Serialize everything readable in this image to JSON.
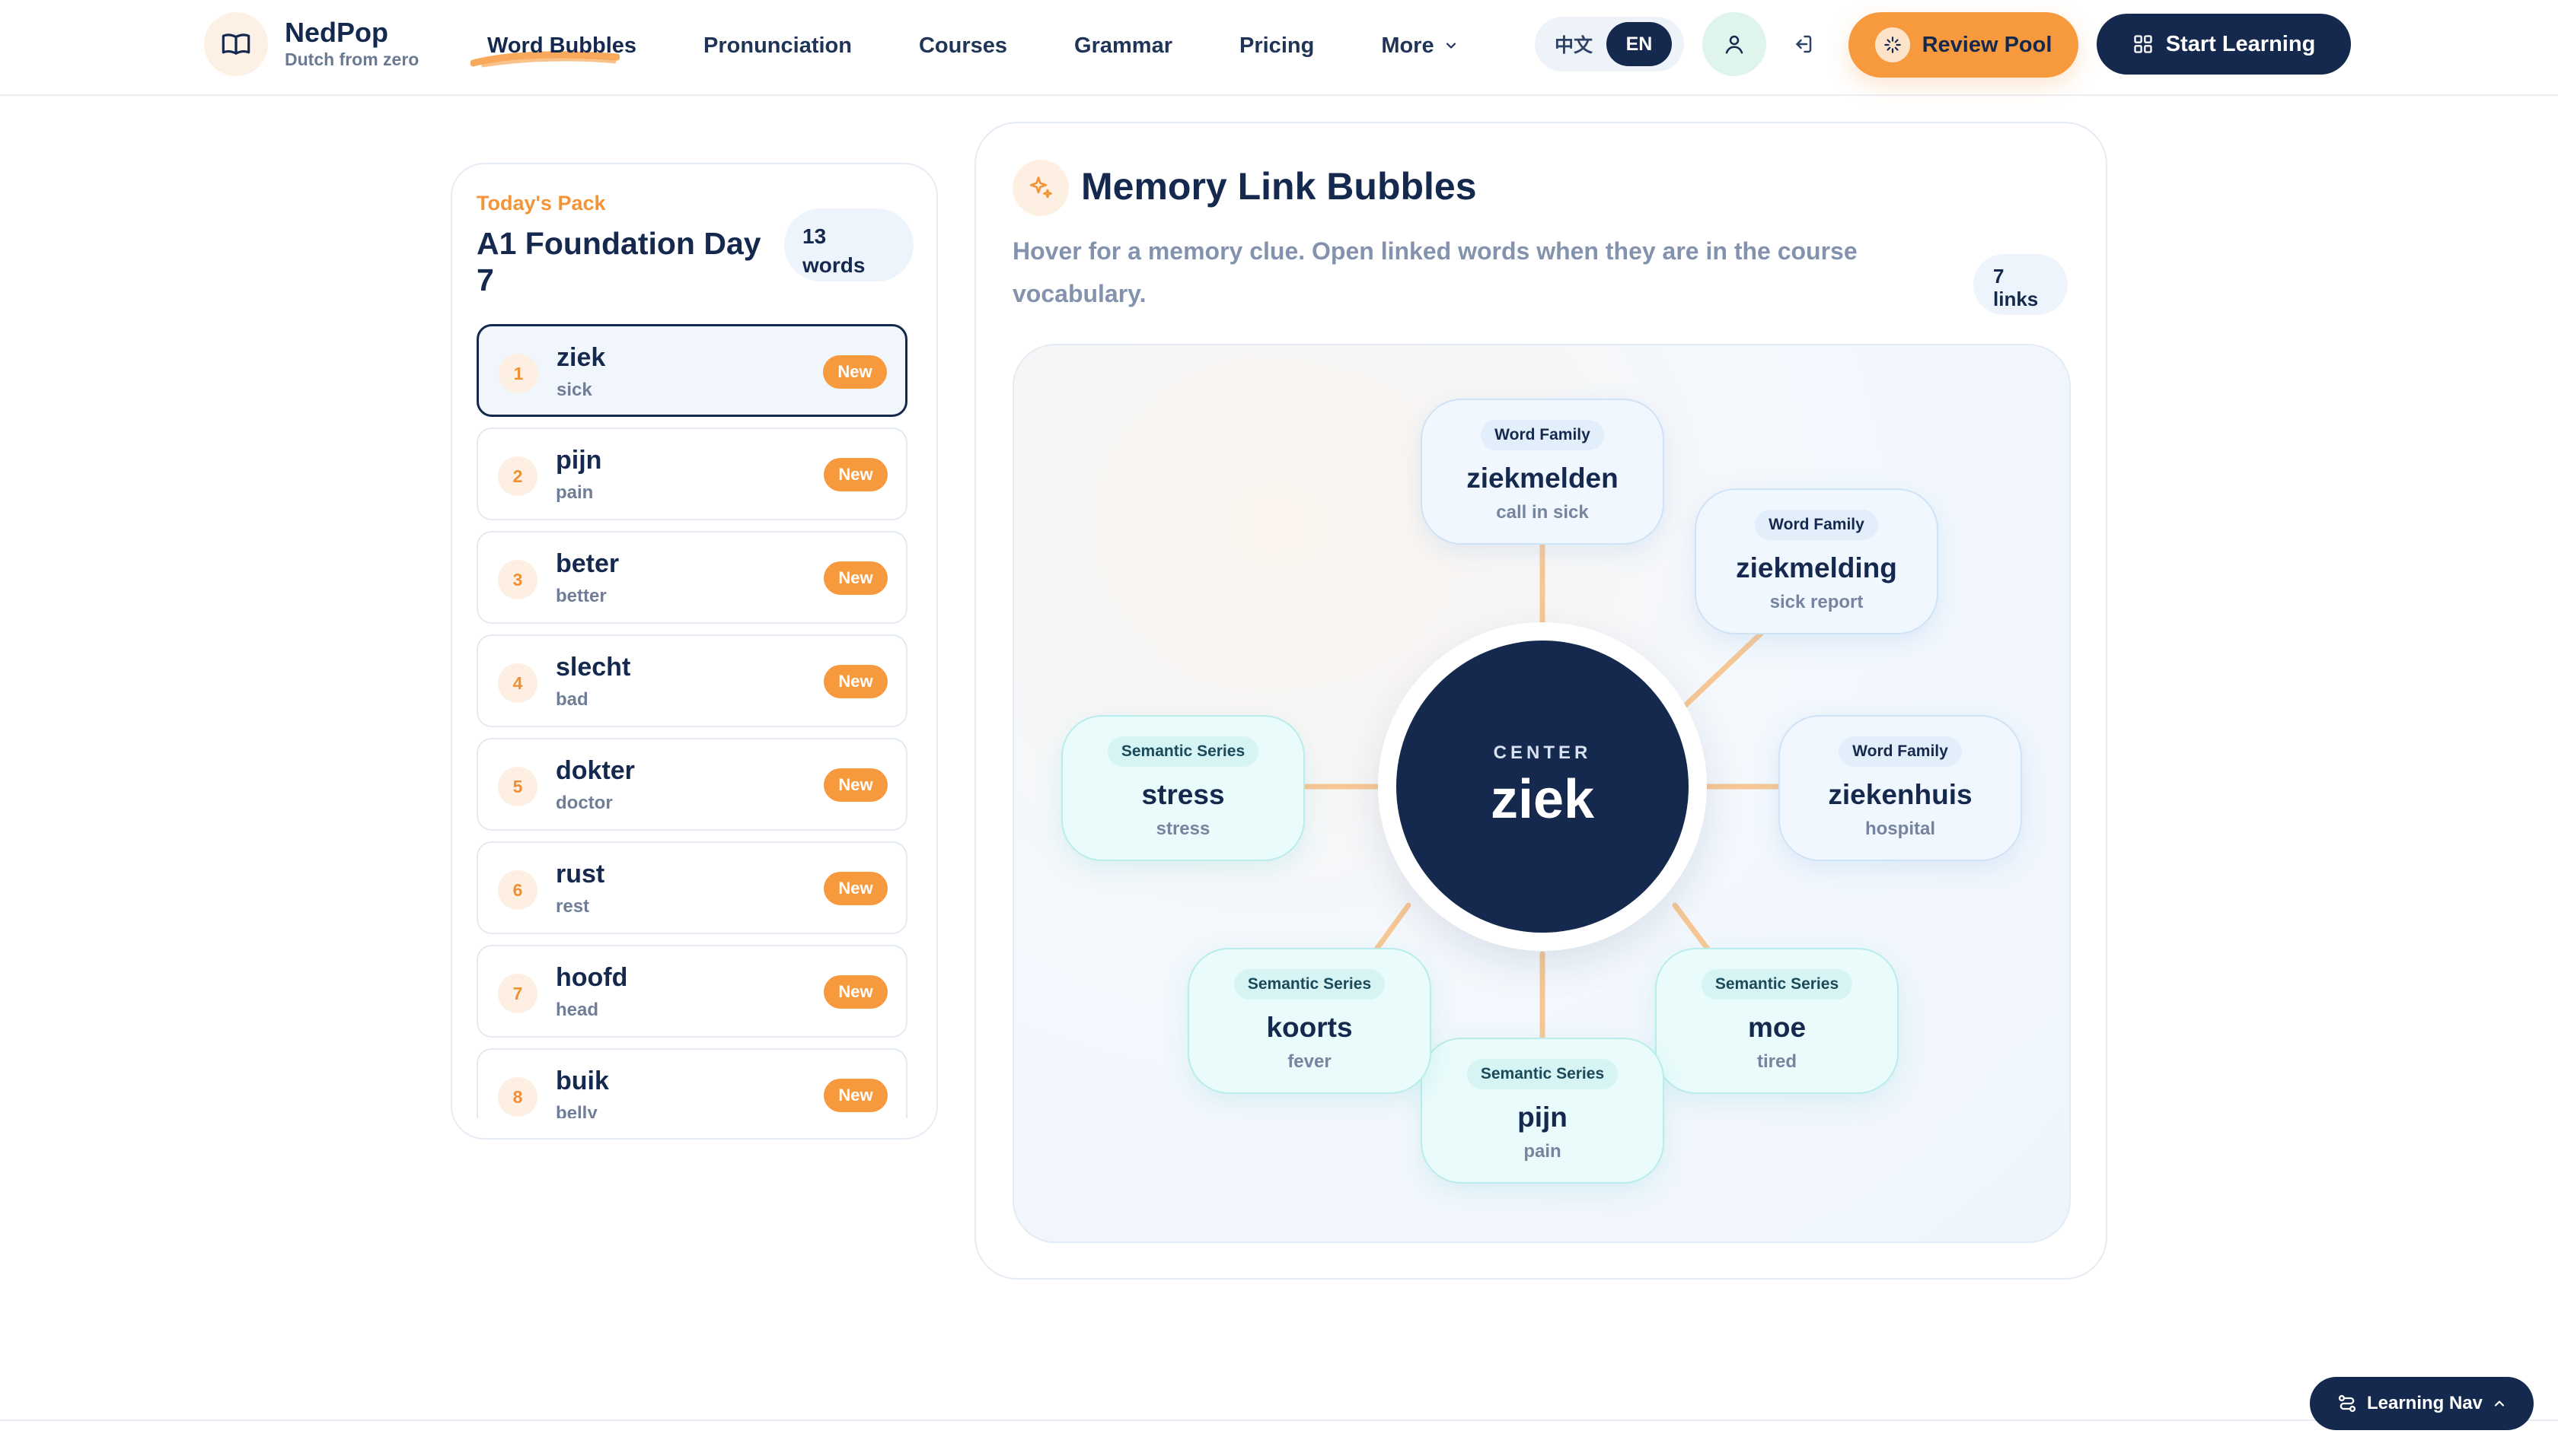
{
  "brand": {
    "name": "NedPop",
    "subtitle": "Dutch from zero"
  },
  "nav": {
    "items": [
      {
        "label": "Word Bubbles",
        "active": true
      },
      {
        "label": "Pronunciation"
      },
      {
        "label": "Courses"
      },
      {
        "label": "Grammar"
      },
      {
        "label": "Pricing"
      }
    ],
    "more_label": "More"
  },
  "language": {
    "options": [
      "中文",
      "EN"
    ],
    "active": "EN"
  },
  "actions": {
    "review_label": "Review Pool",
    "start_label": "Start Learning"
  },
  "pack": {
    "kicker": "Today's Pack",
    "title": "A1 Foundation Day 7",
    "count_number": "13",
    "count_unit": "words",
    "words": [
      {
        "num": "1",
        "nl": "ziek",
        "en": "sick",
        "badge": "New",
        "selected": true
      },
      {
        "num": "2",
        "nl": "pijn",
        "en": "pain",
        "badge": "New"
      },
      {
        "num": "3",
        "nl": "beter",
        "en": "better",
        "badge": "New"
      },
      {
        "num": "4",
        "nl": "slecht",
        "en": "bad",
        "badge": "New"
      },
      {
        "num": "5",
        "nl": "dokter",
        "en": "doctor",
        "badge": "New"
      },
      {
        "num": "6",
        "nl": "rust",
        "en": "rest",
        "badge": "New"
      },
      {
        "num": "7",
        "nl": "hoofd",
        "en": "head",
        "badge": "New"
      },
      {
        "num": "8",
        "nl": "buik",
        "en": "belly",
        "badge": "New"
      }
    ]
  },
  "bubbles": {
    "title": "Memory Link Bubbles",
    "description": "Hover for a memory clue. Open linked words when they are in the course vocabulary.",
    "links_number": "7",
    "links_unit": "links",
    "center": {
      "kicker": "CENTER",
      "word": "ziek"
    },
    "nodes": [
      {
        "key": "ziekmelden",
        "type": "Word Family",
        "word": "ziekmelden",
        "translation": "call in sick"
      },
      {
        "key": "ziekmelding",
        "type": "Word Family",
        "word": "ziekmelding",
        "translation": "sick report"
      },
      {
        "key": "ziekenhuis",
        "type": "Word Family",
        "word": "ziekenhuis",
        "translation": "hospital"
      },
      {
        "key": "moe",
        "type": "Semantic Series",
        "word": "moe",
        "translation": "tired"
      },
      {
        "key": "pijn",
        "type": "Semantic Series",
        "word": "pijn",
        "translation": "pain"
      },
      {
        "key": "koorts",
        "type": "Semantic Series",
        "word": "koorts",
        "translation": "fever"
      },
      {
        "key": "stress",
        "type": "Semantic Series",
        "word": "stress",
        "translation": "stress"
      }
    ]
  },
  "footer": {
    "learning_nav_label": "Learning Nav"
  },
  "colors": {
    "navy": "#14294d",
    "orange": "#f79a3e",
    "connector": "#f6c795",
    "family_bubble": "#f1f7fe",
    "semantic_bubble": "#eafbfb"
  }
}
